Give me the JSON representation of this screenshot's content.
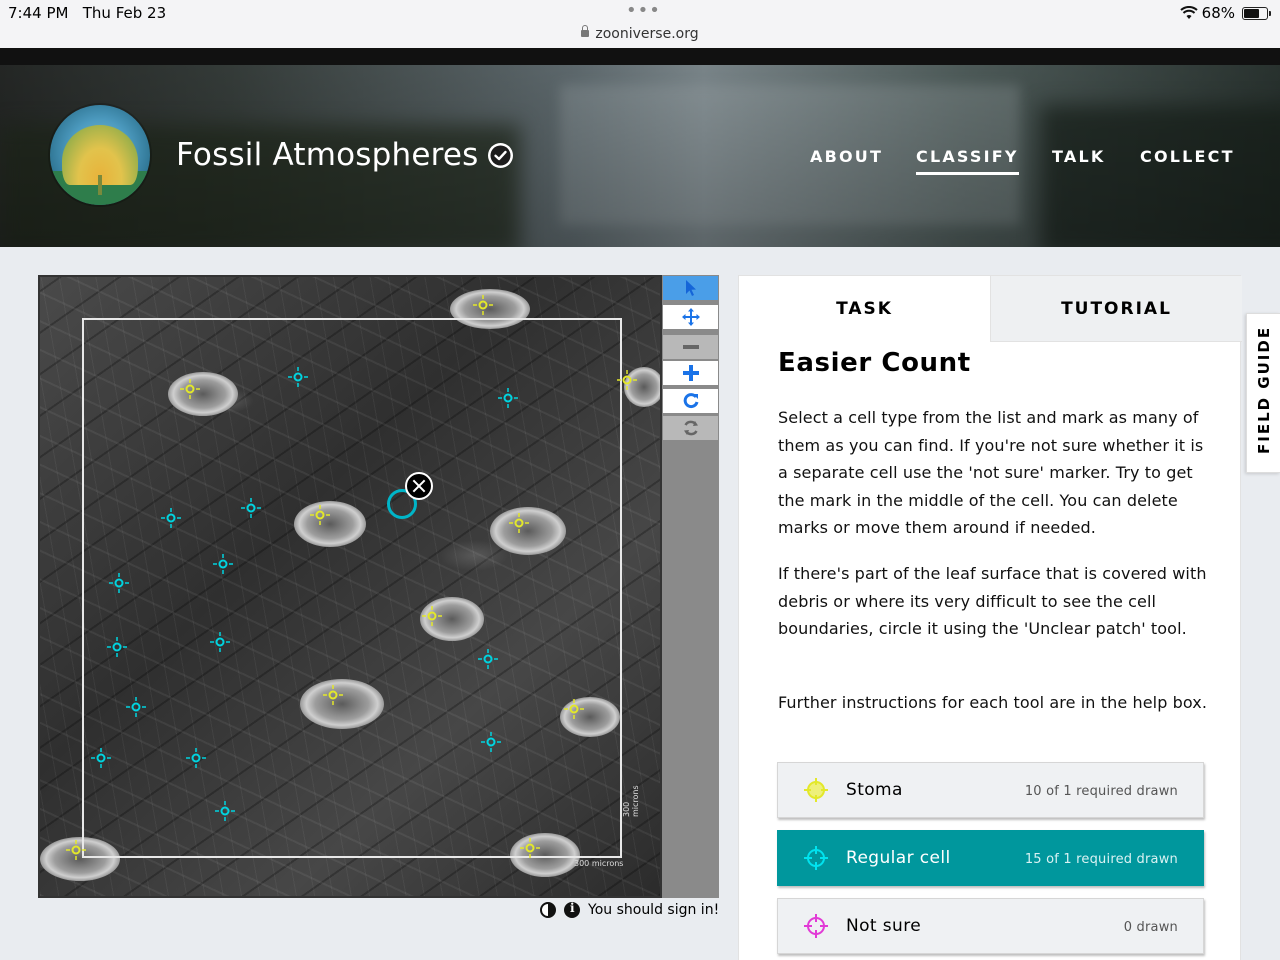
{
  "status_bar": {
    "time": "7:44 PM",
    "date": "Thu Feb 23",
    "url": "zooniverse.org",
    "battery": "68%",
    "battery_level": 0.68
  },
  "project": {
    "title": "Fossil Atmospheres",
    "nav": [
      "ABOUT",
      "CLASSIFY",
      "TALK",
      "COLLECT"
    ],
    "active_nav": "CLASSIFY"
  },
  "viewer": {
    "scale_label_h": "300 microns",
    "scale_label_v": "300 microns",
    "signin_text": "You should sign in!"
  },
  "task_panel": {
    "tabs": [
      "TASK",
      "TUTORIAL"
    ],
    "active_tab": "TASK",
    "heading": "Easier Count",
    "paragraphs": [
      "Select a cell type from the list and mark as many of them as you can find. If you're not sure whether it is a separate cell use the 'not sure' marker. Try to get the mark in the middle of the cell. You can delete marks or move them around if needed.",
      "If there's part of the leaf surface that is covered with debris or where its very difficult to see the cell boundaries, circle it using the 'Unclear patch' tool.",
      "Further instructions for each tool are in the help box."
    ],
    "tools": [
      {
        "label": "Stoma",
        "count": "10 of 1 required drawn",
        "color": "#e3e82a",
        "selected": false
      },
      {
        "label": "Regular cell",
        "count": "15 of 1 required drawn",
        "color": "#00d4e0",
        "selected": true
      },
      {
        "label": "Not sure",
        "count": "0 drawn",
        "color": "#e23ad6",
        "selected": false
      }
    ]
  },
  "field_guide_label": "FIELD GUIDE",
  "colors": {
    "accent_teal": "#00979d",
    "stoma_yellow": "#e3e82a",
    "cell_cyan": "#00d4e0",
    "notsure_magenta": "#e23ad6",
    "toolbar_active": "#4a9ee8"
  }
}
